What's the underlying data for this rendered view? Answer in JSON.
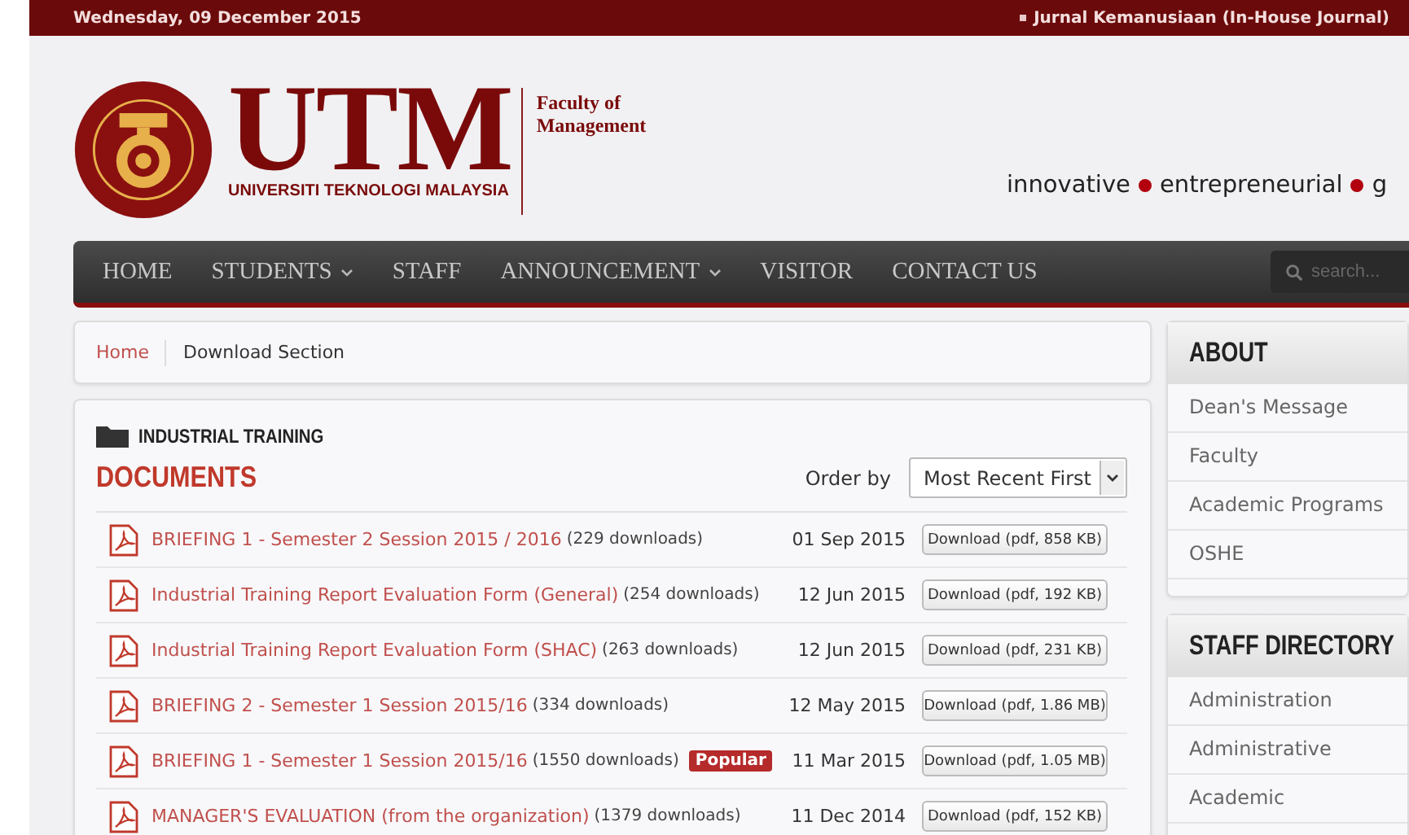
{
  "top_bar": {
    "date": "Wednesday, 09 December 2015",
    "link": "Jurnal Kemanusiaan (In-House Journal)"
  },
  "header": {
    "logo_text": "UTM",
    "logo_subtitle": "UNIVERSITI TEKNOLOGI MALAYSIA",
    "faculty": "Faculty of Management",
    "tagline": [
      "innovative",
      "entrepreneurial",
      "g"
    ]
  },
  "nav": {
    "items": [
      {
        "label": "HOME",
        "has_dropdown": false
      },
      {
        "label": "STUDENTS",
        "has_dropdown": true
      },
      {
        "label": "STAFF",
        "has_dropdown": false
      },
      {
        "label": "ANNOUNCEMENT",
        "has_dropdown": true
      },
      {
        "label": "VISITOR",
        "has_dropdown": false
      },
      {
        "label": "CONTACT US",
        "has_dropdown": false
      }
    ],
    "search": {
      "placeholder": "search..."
    }
  },
  "breadcrumb": [
    "Home",
    "Download Section"
  ],
  "category": "INDUSTRIAL TRAINING",
  "section_title": "DOCUMENTS",
  "order": {
    "label": "Order by",
    "value": "Most Recent First"
  },
  "documents": [
    {
      "title": "BRIEFING 1 - Semester 2 Session 2015 / 2016",
      "downloads": "(229 downloads)",
      "date": "01 Sep 2015",
      "button": "Download (pdf, 858 KB)"
    },
    {
      "title": "Industrial Training Report Evaluation Form (General)",
      "downloads": "(254 downloads)",
      "date": "12 Jun 2015",
      "button": "Download (pdf, 192 KB)"
    },
    {
      "title": "Industrial Training Report Evaluation Form (SHAC)",
      "downloads": "(263 downloads)",
      "date": "12 Jun 2015",
      "button": "Download (pdf, 231 KB)"
    },
    {
      "title": "BRIEFING 2 - Semester 1 Session 2015/16",
      "downloads": "(334 downloads)",
      "date": "12 May 2015",
      "button": "Download (pdf, 1.86 MB)"
    },
    {
      "title": "BRIEFING 1 - Semester 1 Session 2015/16",
      "downloads": "(1550 downloads)",
      "badge": "Popular",
      "date": "11 Mar 2015",
      "button": "Download (pdf, 1.05 MB)"
    },
    {
      "title": "MANAGER'S EVALUATION (from the organization)",
      "downloads": "(1379 downloads)",
      "date": "11 Dec 2014",
      "button": "Download (pdf, 152 KB)"
    }
  ],
  "sidebar": [
    {
      "title": "ABOUT",
      "items": [
        "Dean's Message",
        "Faculty",
        "Academic Programs",
        "OSHE"
      ]
    },
    {
      "title": "STAFF DIRECTORY",
      "items": [
        "Administration",
        "Administrative",
        "Academic"
      ]
    }
  ]
}
